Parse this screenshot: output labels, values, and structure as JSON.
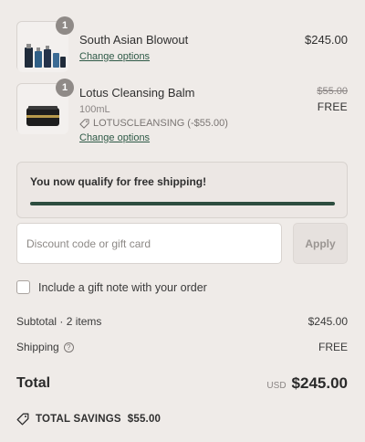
{
  "items": [
    {
      "qty": "1",
      "name": "South Asian Blowout",
      "change_link": "Change options",
      "price": "$245.00"
    },
    {
      "qty": "1",
      "name": "Lotus Cleansing Balm",
      "variant": "100mL",
      "discount_code": "LOTUSCLEANSING (-$55.00)",
      "change_link": "Change options",
      "original_price": "$55.00",
      "price": "FREE"
    }
  ],
  "shipping_banner": {
    "text": "You now qualify for free shipping!",
    "progress": 1.0
  },
  "discount": {
    "placeholder": "Discount code or gift card",
    "apply_label": "Apply"
  },
  "gift_note": {
    "label": "Include a gift note with your order",
    "checked": false
  },
  "summary": {
    "subtotal_label": "Subtotal · 2 items",
    "subtotal_value": "$245.00",
    "shipping_label": "Shipping",
    "shipping_value": "FREE",
    "total_label": "Total",
    "currency": "USD",
    "total_value": "$245.00",
    "savings_label": "TOTAL SAVINGS",
    "savings_value": "$55.00"
  },
  "colors": {
    "accent": "#2d4d3f",
    "background": "#efebe8",
    "link": "#2f5a47"
  }
}
